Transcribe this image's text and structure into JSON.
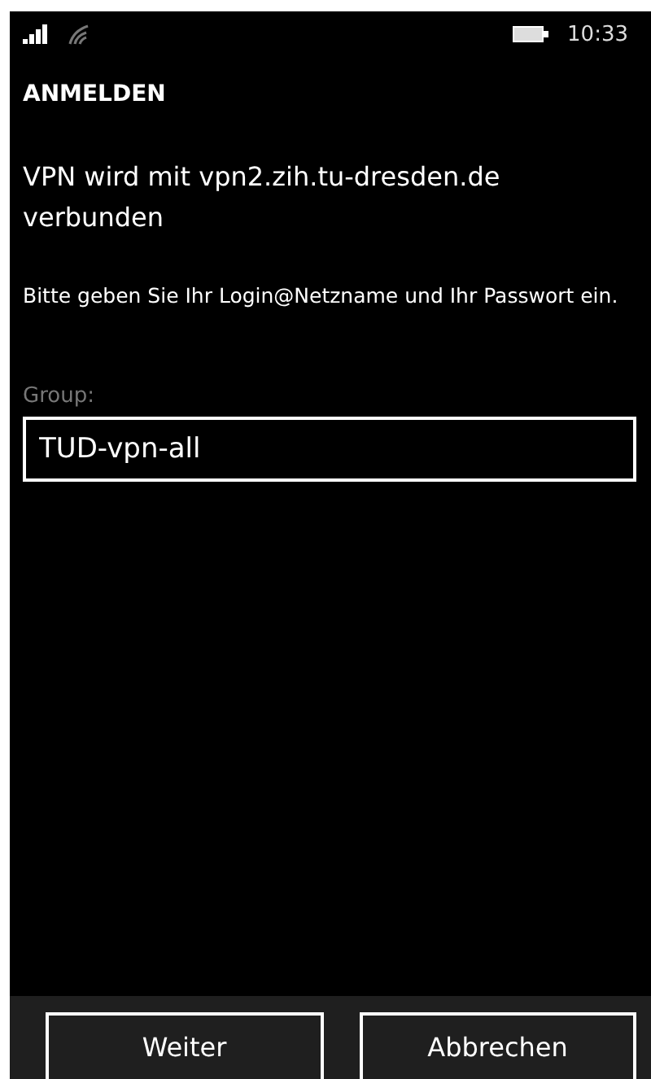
{
  "status_bar": {
    "time": "10:33"
  },
  "page": {
    "title": "ANMELDEN",
    "message": "VPN wird mit vpn2.zih.tu-dresden.de verbunden",
    "instruction": "Bitte geben Sie Ihr Login@Netzname und Ihr Passwort ein."
  },
  "group_field": {
    "label": "Group:",
    "value": "TUD-vpn-all"
  },
  "buttons": [
    "Weiter",
    "Abbrechen"
  ]
}
